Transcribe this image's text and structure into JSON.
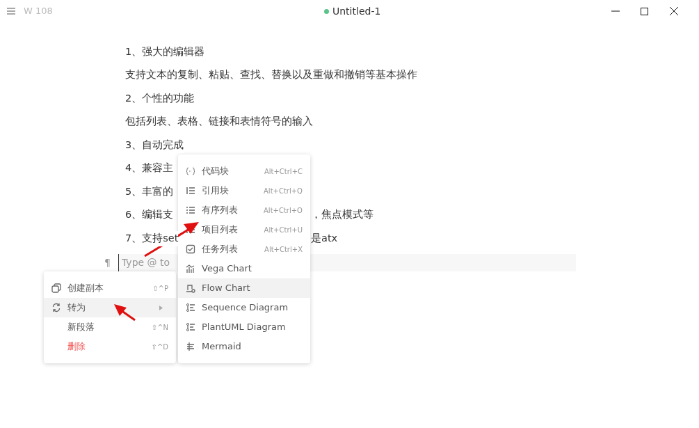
{
  "titlebar": {
    "word_count": "W 108",
    "title": "Untitled-1",
    "saved": true
  },
  "document": {
    "lines": [
      {
        "text": "1、强大的编辑器"
      },
      {
        "text": "支持文本的复制、粘贴、查找、替换以及重做和撤销等基本操作"
      },
      {
        "text": "2、个性的功能"
      },
      {
        "text": "包括列表、表格、链接和表情符号的输入"
      },
      {
        "text": "3、自动完成"
      },
      {
        "text": "4、兼容主"
      },
      {
        "text": "5、丰富的"
      },
      {
        "text": "6、编辑支",
        "tail": "，焦点模式等"
      },
      {
        "text": "7、支持set",
        "tail": "是atx"
      }
    ],
    "input": {
      "marker": "¶",
      "placeholder": "Type @ to"
    }
  },
  "context_menu": {
    "items": [
      {
        "kind": "copy",
        "label": "创建副本",
        "shortcut": "⇧^P",
        "selected": false
      },
      {
        "kind": "convert",
        "label": "转为",
        "submenu": true,
        "selected": true
      },
      {
        "kind": "plain",
        "label": "新段落",
        "shortcut": "⇧^N",
        "selected": false
      },
      {
        "kind": "danger",
        "label": "删除",
        "shortcut": "⇧^D",
        "selected": false
      }
    ]
  },
  "submenu": {
    "items": [
      {
        "kind": "code",
        "label": "代码块",
        "shortcut": "Alt+Ctrl+C",
        "selected": false
      },
      {
        "kind": "quote",
        "label": "引用块",
        "shortcut": "Alt+Ctrl+Q",
        "selected": false
      },
      {
        "kind": "ordered",
        "label": "有序列表",
        "shortcut": "Alt+Ctrl+O",
        "selected": false
      },
      {
        "kind": "bullet",
        "label": "项目列表",
        "shortcut": "Alt+Ctrl+U",
        "selected": false
      },
      {
        "kind": "task",
        "label": "任务列表",
        "shortcut": "Alt+Ctrl+X",
        "selected": false
      },
      {
        "kind": "chart",
        "label": "Vega Chart",
        "selected": false
      },
      {
        "kind": "flow",
        "label": "Flow Chart",
        "selected": true
      },
      {
        "kind": "diagram",
        "label": "Sequence Diagram",
        "selected": false
      },
      {
        "kind": "diagram",
        "label": "PlantUML Diagram",
        "selected": false
      },
      {
        "kind": "mermaid",
        "label": "Mermaid",
        "selected": false
      }
    ]
  }
}
